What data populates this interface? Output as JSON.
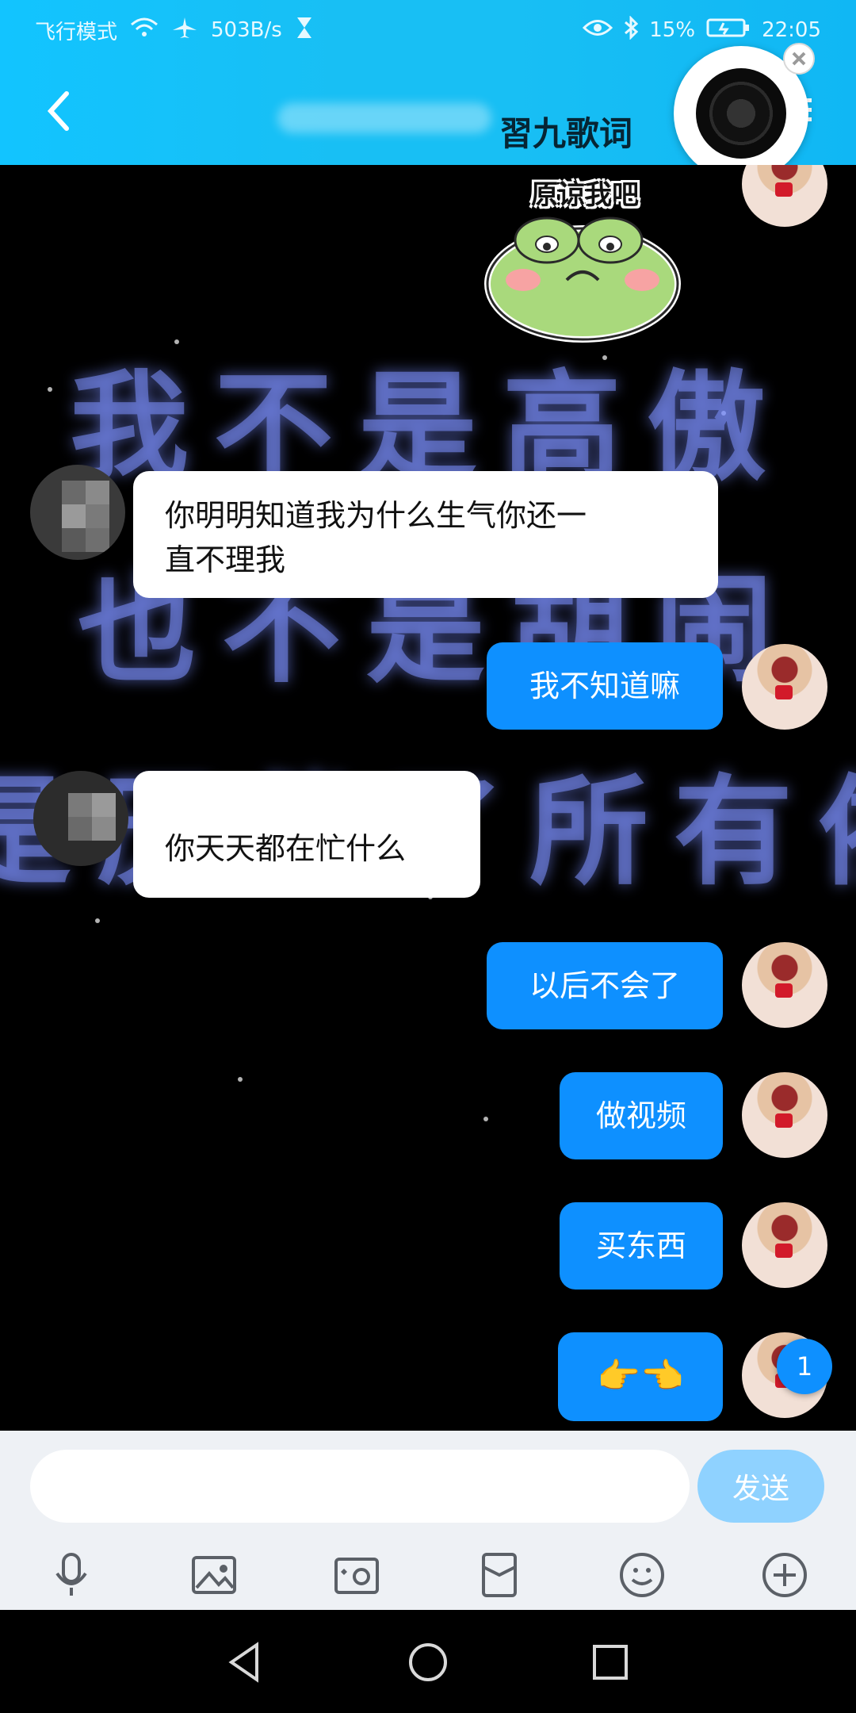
{
  "status_bar": {
    "airplane_mode_label": "飞行模式",
    "network_speed": "503B/s",
    "battery": "15%",
    "time": "22:05"
  },
  "header": {
    "title": "習九歌词"
  },
  "chat": {
    "sticker_caption": "原谅我吧",
    "background_text": [
      "我不是高傲",
      "也不是胡闹",
      "是厌倦了所有依"
    ],
    "messages": [
      {
        "side": "left",
        "text": "你明明知道我为什么生气你还一\n直不理我"
      },
      {
        "side": "right",
        "text": "我不知道嘛"
      },
      {
        "side": "left",
        "text": "你天天都在忙什么"
      },
      {
        "side": "right",
        "text": "以后不会了"
      },
      {
        "side": "right",
        "text": "做视频"
      },
      {
        "side": "right",
        "text": "买东西"
      },
      {
        "side": "right",
        "text": "👉👈"
      }
    ],
    "unread_count": "1"
  },
  "composer": {
    "input_value": "",
    "send_label": "发送"
  },
  "toolbar": {
    "icons": [
      "microphone-icon",
      "image-icon",
      "camera-icon",
      "red-packet-icon",
      "emoji-icon",
      "plus-icon"
    ]
  },
  "navbar": {
    "icons": [
      "back-triangle-icon",
      "home-circle-icon",
      "recents-square-icon"
    ]
  },
  "colors": {
    "header": "#18bff4",
    "bubble_right": "#0e90ff",
    "bubble_left": "#ffffff"
  }
}
